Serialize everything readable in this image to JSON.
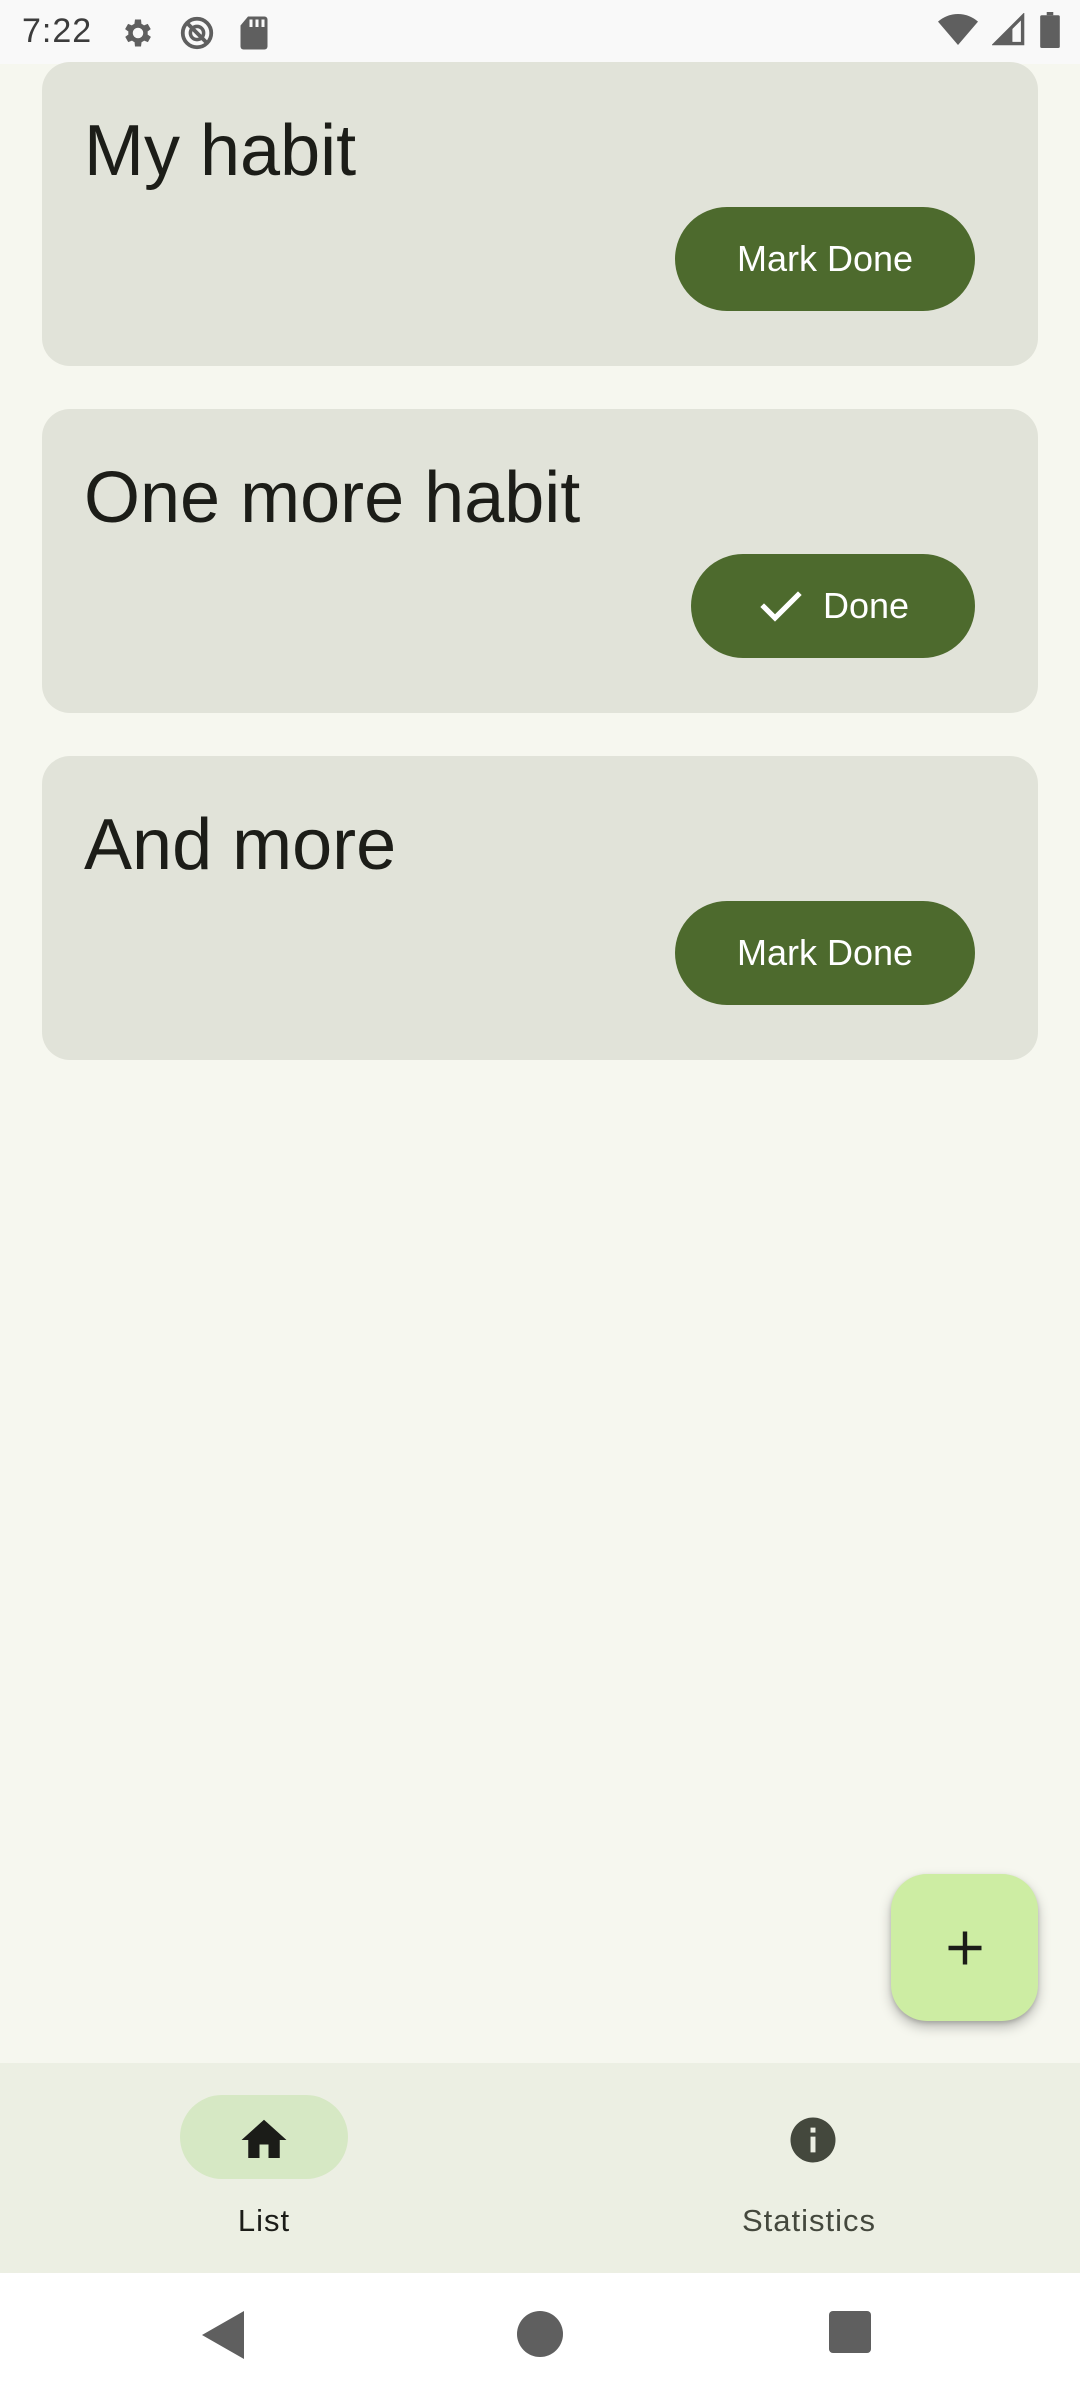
{
  "status_bar": {
    "time": "7:22",
    "left_icons": [
      "settings-icon",
      "blocked-icon",
      "sd-card-icon"
    ],
    "right_icons": [
      "wifi-icon",
      "signal-icon",
      "battery-icon"
    ]
  },
  "habits": [
    {
      "title": "My habit",
      "button_label": "Mark Done",
      "done": false
    },
    {
      "title": "One more habit",
      "button_label": "Done",
      "done": true
    },
    {
      "title": "And more",
      "button_label": "Mark Done",
      "done": false
    }
  ],
  "fab": {
    "icon": "plus-icon"
  },
  "bottom_nav": {
    "items": [
      {
        "label": "List",
        "icon": "home-icon",
        "selected": true
      },
      {
        "label": "Statistics",
        "icon": "info-icon",
        "selected": false
      }
    ]
  },
  "system_nav": {
    "icons": [
      "back-icon",
      "home-circle-icon",
      "recents-icon"
    ]
  },
  "colors": {
    "background": "#f6f7ef",
    "card": "#e1e3d9",
    "primary": "#4d6a2d",
    "fab": "#cdeda3",
    "nav_bar": "#ecefe3",
    "nav_indicator": "#d6e8c4"
  }
}
